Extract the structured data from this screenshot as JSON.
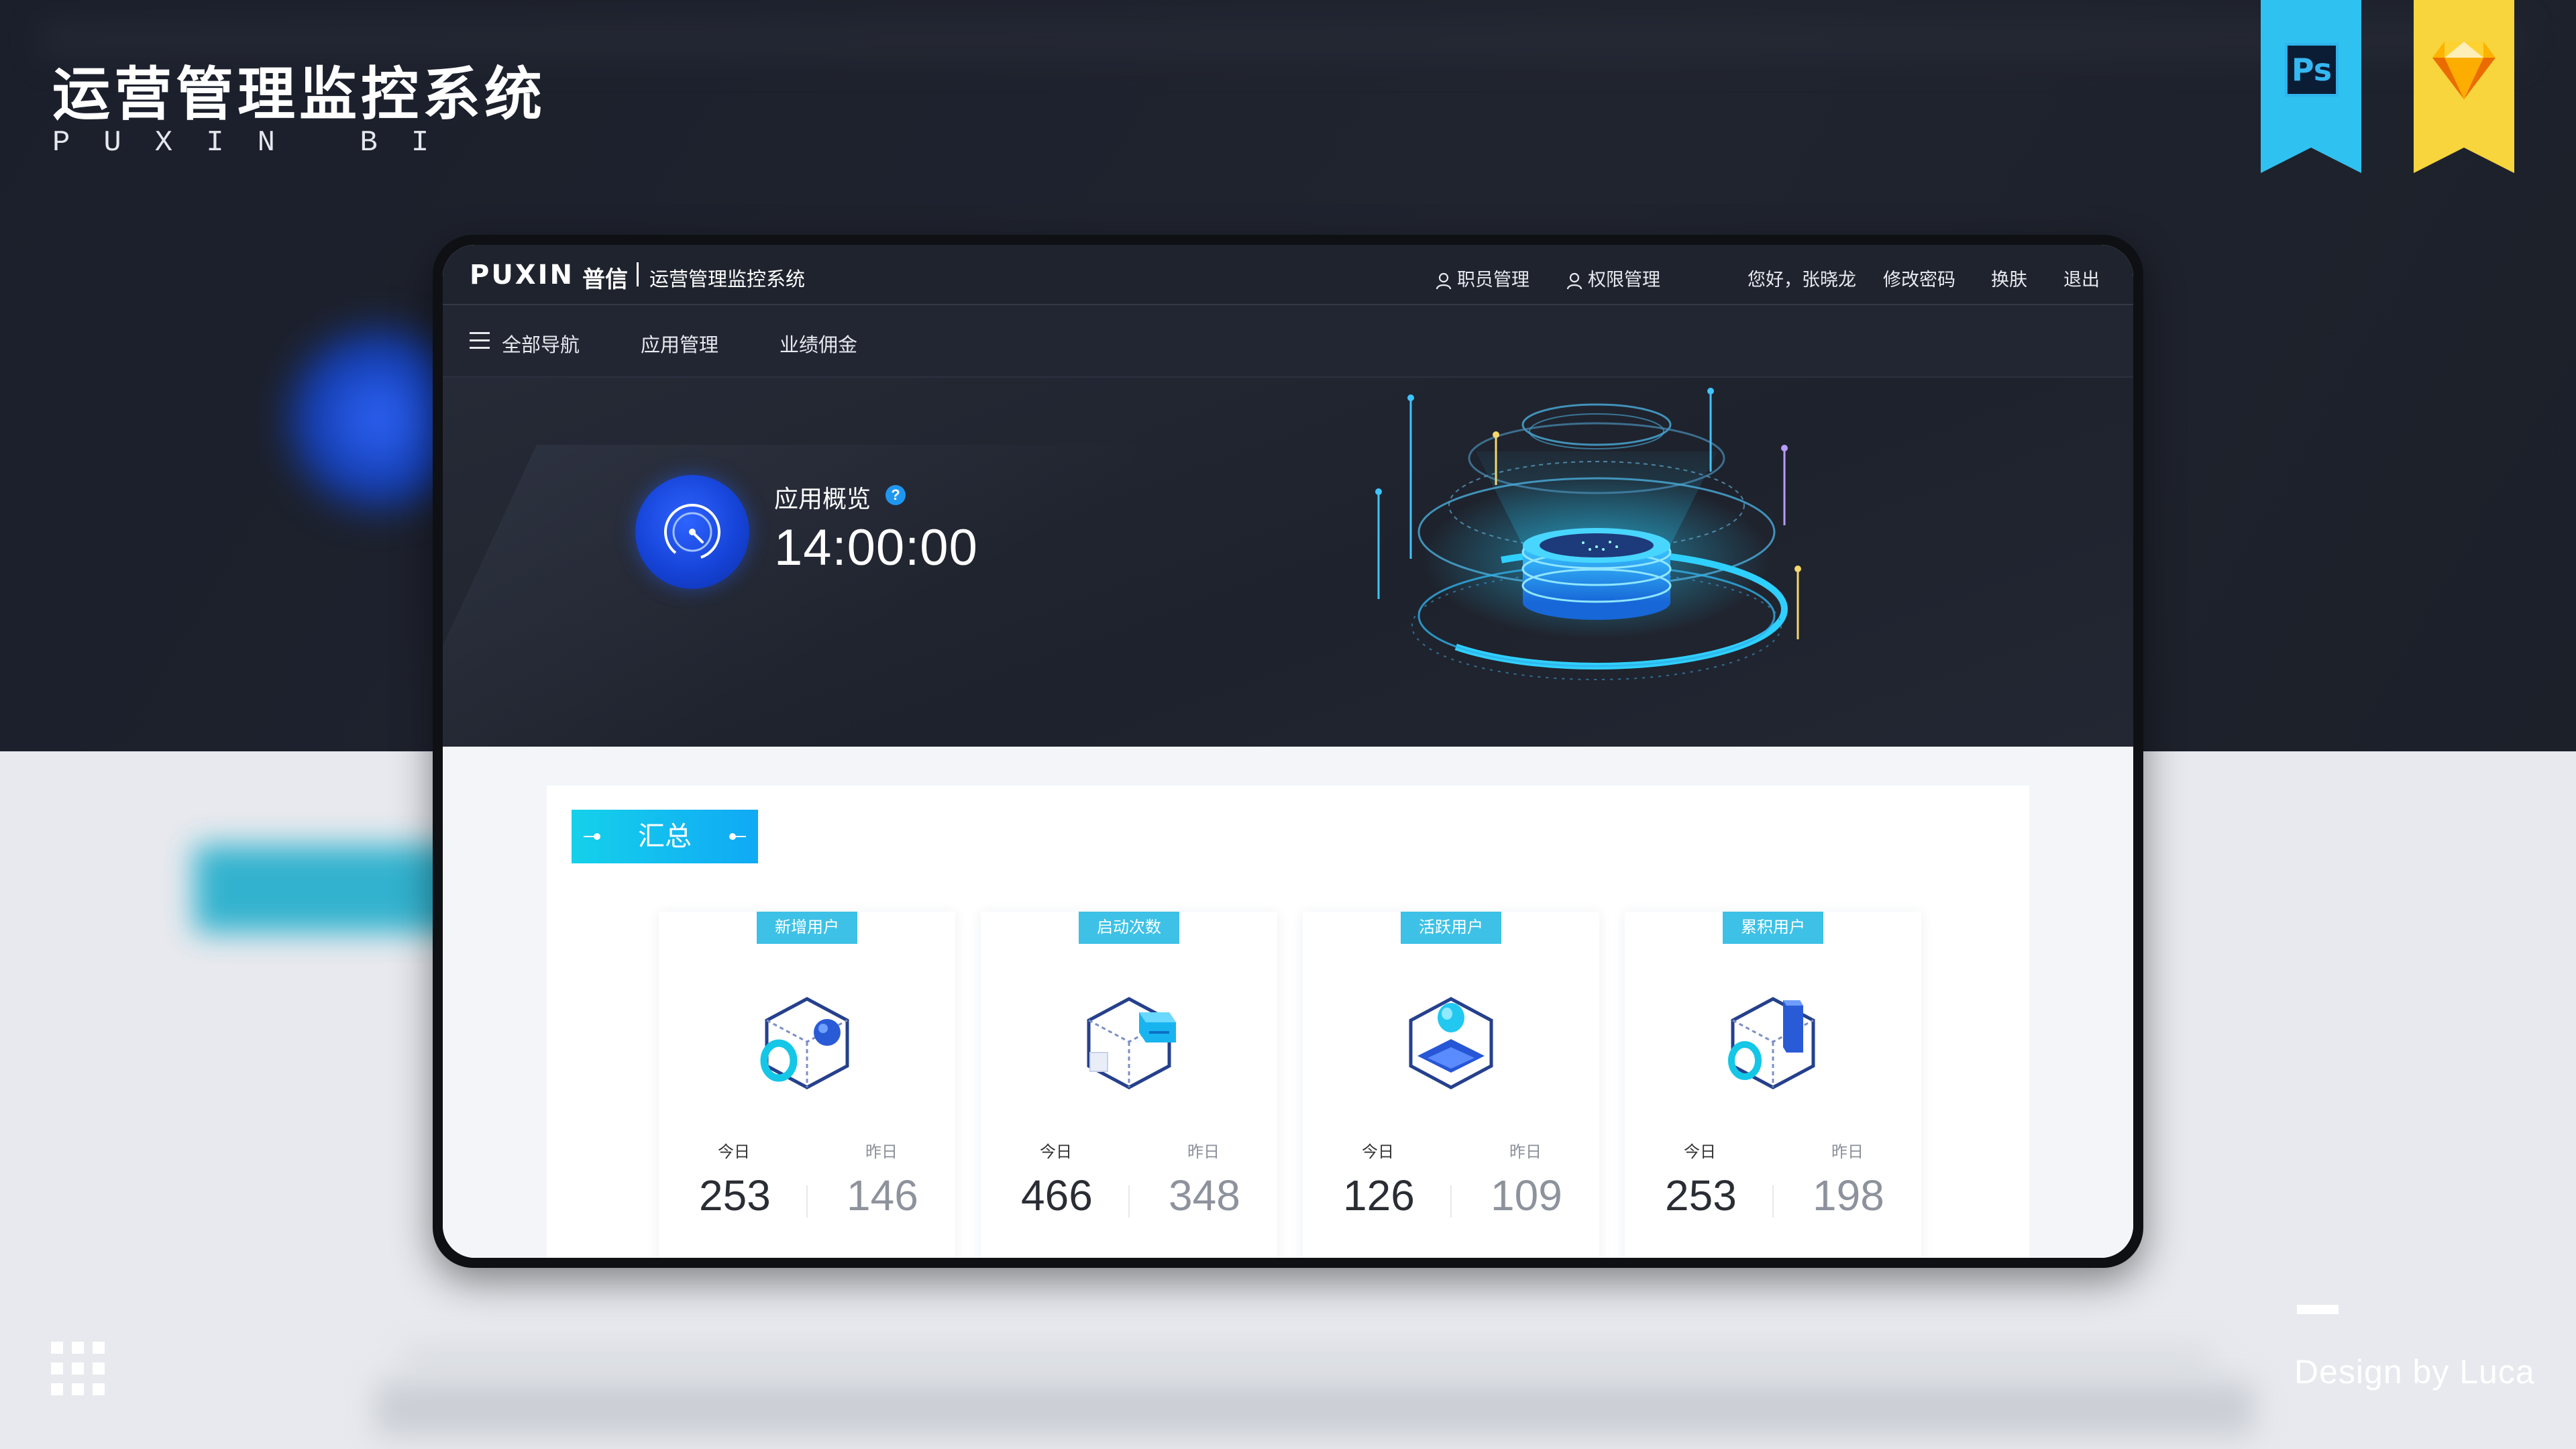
{
  "showcase": {
    "title": "运营管理监控系统",
    "subtitle": "PUXIN BI",
    "ribbon_ps": "Ps",
    "credit": "Design by Luca"
  },
  "header": {
    "logo": "PUXIN",
    "logo_cn": "普信",
    "system_name": "运营管理监控系统",
    "staff_mgmt": "职员管理",
    "perm_mgmt": "权限管理",
    "greeting": "您好，张晓龙",
    "change_password": "修改密码",
    "skin": "换肤",
    "logout": "退出"
  },
  "nav": {
    "all_nav": "全部导航",
    "app_mgmt": "应用管理",
    "commission": "业绩佣金"
  },
  "hero": {
    "overview_label": "应用概览",
    "help_icon": "?",
    "time": "14:00:00"
  },
  "summary": {
    "tab_label": "汇总",
    "today_label": "今日",
    "yesterday_label": "昨日",
    "cards": [
      {
        "title": "新增用户",
        "today": "253",
        "yesterday": "146"
      },
      {
        "title": "启动次数",
        "today": "466",
        "yesterday": "348"
      },
      {
        "title": "活跃用户",
        "today": "126",
        "yesterday": "109"
      },
      {
        "title": "累积用户",
        "today": "253",
        "yesterday": "198"
      }
    ]
  },
  "colors": {
    "accent_cyan": "#15d1ea",
    "accent_blue": "#1f6bff",
    "header_bg": "#1f232d",
    "ps_ribbon": "#2fc1ef",
    "sketch_ribbon": "#f8d43d"
  }
}
